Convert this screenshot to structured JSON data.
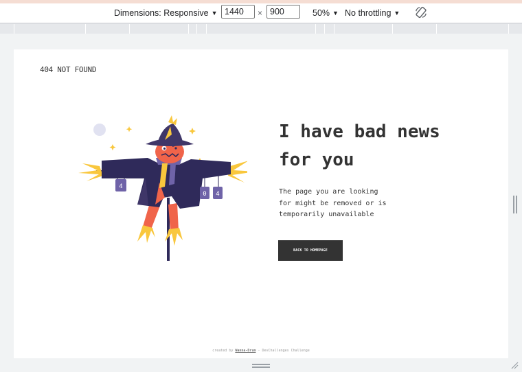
{
  "devtools": {
    "dimensions_label": "Dimensions: Responsive",
    "width_value": "1440",
    "height_value": "900",
    "times_symbol": "×",
    "zoom_label": "50%",
    "throttling_label": "No throttling",
    "icons": {
      "dropdown": "caret-down-icon",
      "rotate": "rotate-icon",
      "resize": "resize-corner-icon"
    }
  },
  "page": {
    "brand": "404 NOT FOUND",
    "headline_line1": "I have bad news",
    "headline_line2": "for you",
    "description_line1": "The page you are looking",
    "description_line2": "for might be removed or is",
    "description_line3": "temporarily unavailable",
    "button_label": "BACK TO HOMEPAGE",
    "credit_prefix": "created by",
    "credit_author": "Wanna-Drum",
    "credit_suffix": "- DevChallenges Challenge",
    "sign_left": "4",
    "sign_right_a": "0",
    "sign_right_b": "4"
  },
  "colors": {
    "button_bg": "#333333",
    "text": "#333333",
    "hat": "#3f3668",
    "coat": "#2f2a5a",
    "face": "#f0644a",
    "straw": "#f9c73d",
    "moon": "#e1e2f1"
  }
}
